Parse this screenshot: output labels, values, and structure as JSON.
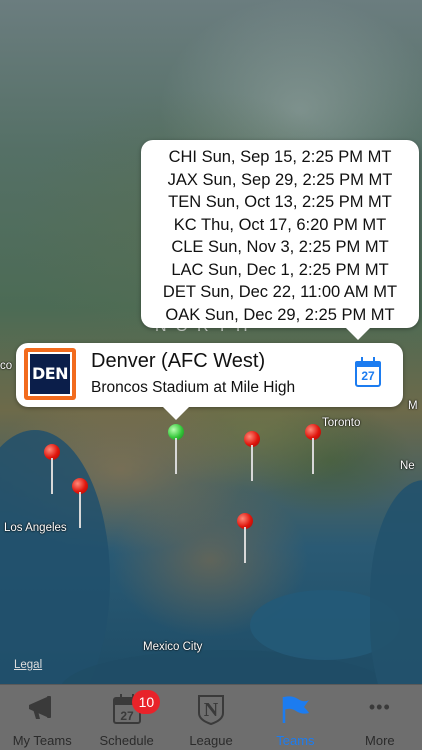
{
  "map": {
    "region_label": "NORTH",
    "cities": [
      {
        "name": "co"
      },
      {
        "name": "Los Angeles"
      },
      {
        "name": "Mexico City"
      },
      {
        "name": "Toronto"
      },
      {
        "name": "Ne"
      },
      {
        "name": "M"
      }
    ],
    "legal": "Legal"
  },
  "schedule_tooltip": {
    "games": [
      "CHI Sun, Sep 15, 2:25 PM MT",
      "JAX Sun, Sep 29, 2:25 PM MT",
      "TEN Sun, Oct 13, 2:25 PM MT",
      "KC Thu, Oct 17, 6:20 PM MT",
      "CLE Sun, Nov 3, 2:25 PM MT",
      "LAC Sun, Dec 1, 2:25 PM MT",
      "DET Sun, Dec 22, 11:00 AM MT",
      "OAK Sun, Dec 29, 2:25 PM MT"
    ]
  },
  "callout": {
    "logo_text": "DEN",
    "team_name": "Denver (AFC West)",
    "stadium": "Broncos Stadium at Mile High",
    "calendar_day": "27",
    "accent": "#1c7cf0",
    "logo_bg": "#0b1e4a",
    "logo_border": "#f26b1d"
  },
  "tabbar": {
    "tabs": [
      {
        "label": "My Teams",
        "icon": "megaphone-icon",
        "active": false
      },
      {
        "label": "Schedule",
        "icon": "calendar-icon",
        "active": false,
        "badge": "10",
        "icon_text": "27"
      },
      {
        "label": "League",
        "icon": "league-logo-icon",
        "active": false,
        "icon_text": "N"
      },
      {
        "label": "Teams",
        "icon": "flag-icon",
        "active": true
      },
      {
        "label": "More",
        "icon": "ellipsis-icon",
        "active": false,
        "icon_text": "•••"
      }
    ],
    "active_color": "#1c7cf0",
    "badge_color": "#e8232a"
  }
}
